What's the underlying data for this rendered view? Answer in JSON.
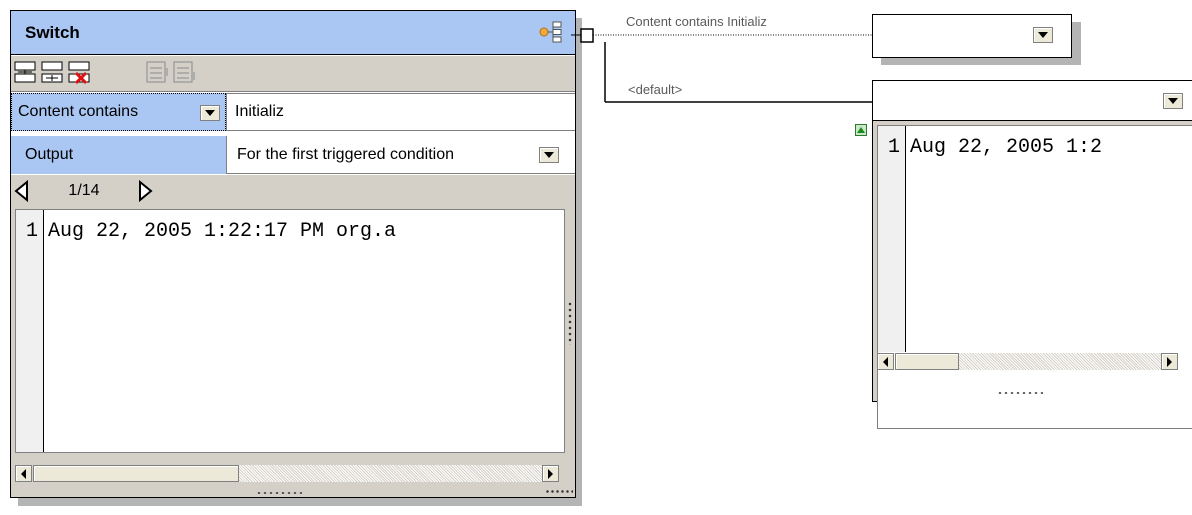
{
  "switch_box": {
    "title": "Switch",
    "condition_type": "Content contains",
    "condition_value": "Initializ",
    "output_label": "Output",
    "output_value": "For the first triggered condition",
    "page": "1/14",
    "line_number": "1",
    "preview_text": "Aug 22, 2005 1:22:17 PM org.a"
  },
  "connections": {
    "condition_label": "Content contains Initializ",
    "default_label": "<default>"
  },
  "output_box": {
    "line_number": "1",
    "preview_text": "Aug 22, 2005 1:2"
  },
  "icons": {
    "switch": "tree-switch-icon",
    "toolbar": [
      "insert-condition-icon",
      "append-condition-icon",
      "delete-condition-icon",
      "move-up-icon",
      "move-down-icon"
    ]
  },
  "colors": {
    "title_bar": "#aac6f2",
    "toolbar": "#d4d0c8",
    "default_link": "#000000",
    "condition_link": "#000000"
  }
}
